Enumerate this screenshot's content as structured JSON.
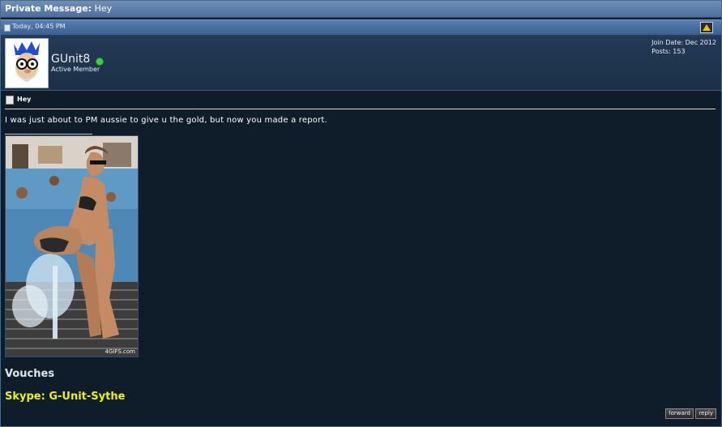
{
  "titlebar": {
    "label": "Private Message:",
    "subject": "Hey"
  },
  "datebar": {
    "date": "Today, 04:45 PM",
    "alert_icon": "warning-triangle-icon"
  },
  "user": {
    "name": "GUnit8",
    "title": "Active Member",
    "status_color": "#3cd23c",
    "join_date": "Join Date: Dec 2012",
    "posts": "Posts: 153"
  },
  "message": {
    "subject": "Hey",
    "text": "I was just about to PM aussie to give u the gold, but now you made a report.",
    "gif_watermark": "4GIFS.com"
  },
  "signature": {
    "vouches": "Vouches",
    "skype": "Skype: G-Unit-Sythe",
    "skype_color": "#f2f200"
  },
  "buttons": {
    "forward": "forward",
    "reply": "reply"
  }
}
